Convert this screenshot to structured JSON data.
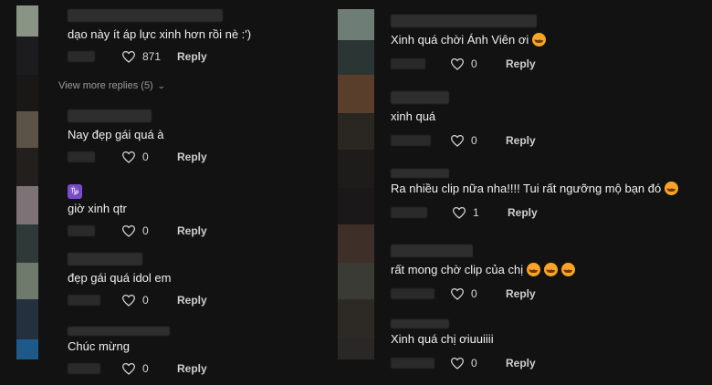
{
  "view_more": "View more replies (5)",
  "reply_label": "Reply",
  "left_comments": [
    {
      "text": "dạo này ít áp lực xinh hơn rồi nè :')",
      "likes": "871"
    },
    {
      "text": "Nay đẹp gái quá à",
      "likes": "0"
    },
    {
      "text": "giờ xinh qtr",
      "likes": "0",
      "icon": "capricorn-emoji-icon"
    },
    {
      "text": "đẹp gái quá idol em",
      "likes": "0"
    },
    {
      "text": "Chúc mừng",
      "likes": "0"
    }
  ],
  "right_comments": [
    {
      "text": "Xinh quá chời Ánh Viên ơi",
      "likes": "0",
      "emoji_count": 1
    },
    {
      "text": "xinh quá",
      "likes": "0",
      "emoji_count": 0
    },
    {
      "text": "Ra nhiều clip nữa nha!!!! Tui rất ngưỡng mộ bạn đó",
      "likes": "1",
      "emoji_count": 1
    },
    {
      "text": "rất mong chờ clip của chị",
      "likes": "0",
      "emoji_count": 3
    },
    {
      "text": "Xinh quá chị ơiuuiiii",
      "likes": "0",
      "emoji_count": 0
    }
  ],
  "colors": {
    "background": "#121212",
    "text": "#f0f0f0",
    "muted": "#9a9a9a"
  }
}
